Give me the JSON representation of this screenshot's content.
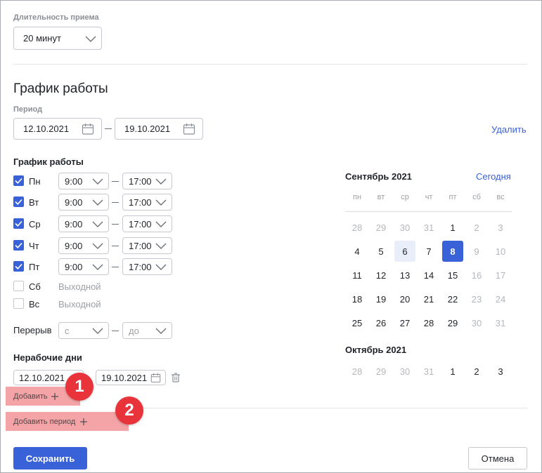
{
  "duration": {
    "label": "Длительность приема",
    "value": "20 минут"
  },
  "schedule": {
    "title": "График работы",
    "period_label": "Период",
    "period_from": "12.10.2021",
    "period_to": "19.10.2021",
    "delete_label": "Удалить",
    "section_label": "График работы",
    "days": [
      {
        "name": "Пн",
        "checked": true,
        "from": "9:00",
        "to": "17:00"
      },
      {
        "name": "Вт",
        "checked": true,
        "from": "9:00",
        "to": "17:00"
      },
      {
        "name": "Ср",
        "checked": true,
        "from": "9:00",
        "to": "17:00"
      },
      {
        "name": "Чт",
        "checked": true,
        "from": "9:00",
        "to": "17:00"
      },
      {
        "name": "Пт",
        "checked": true,
        "from": "9:00",
        "to": "17:00"
      },
      {
        "name": "Сб",
        "checked": false,
        "off_text": "Выходной"
      },
      {
        "name": "Вс",
        "checked": false,
        "off_text": "Выходной"
      }
    ],
    "break_label": "Перерыв",
    "break_from_placeholder": "с",
    "break_to_placeholder": "до"
  },
  "nonworking": {
    "title": "Нерабочие дни",
    "from": "12.10.2021",
    "to": "19.10.2021",
    "add_label": "Добавить",
    "add_period_label": "Добавить период"
  },
  "calendar": {
    "month1_title": "Сентябрь 2021",
    "today_label": "Сегодня",
    "weekdays": [
      "пн",
      "вт",
      "ср",
      "чт",
      "пт",
      "сб",
      "вс"
    ],
    "month1_weeks": [
      [
        "28",
        "29",
        "30",
        "31",
        "1",
        "2",
        "3"
      ],
      [
        "4",
        "5",
        "6",
        "7",
        "8",
        "9",
        "10"
      ],
      [
        "11",
        "12",
        "13",
        "14",
        "15",
        "16",
        "17"
      ],
      [
        "18",
        "19",
        "20",
        "21",
        "22",
        "23",
        "24"
      ],
      [
        "25",
        "26",
        "27",
        "28",
        "29",
        "30",
        "31"
      ]
    ],
    "today_day": "6",
    "selected_day": "8",
    "month2_title": "Октябрь 2021",
    "month2_weeks": [
      [
        "28",
        "29",
        "30",
        "31",
        "1",
        "2",
        "3"
      ]
    ]
  },
  "annotations": {
    "badge1": "1",
    "badge2": "2",
    "highlight_color": "#f4a3a6",
    "badge_color": "#e8333b"
  },
  "footer": {
    "save_label": "Сохранить",
    "cancel_label": "Отмена"
  },
  "colors": {
    "accent": "#3a62d8"
  }
}
